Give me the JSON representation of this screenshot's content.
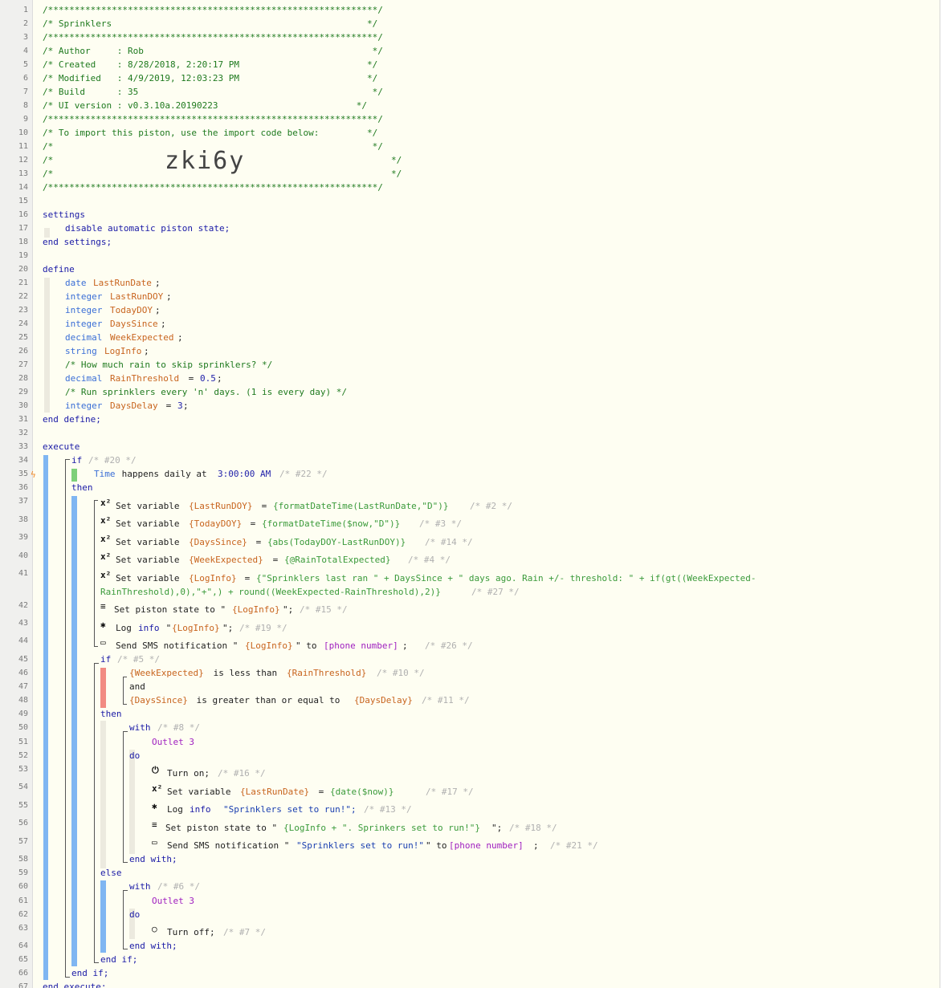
{
  "line_numbers": [
    "1",
    "2",
    "3",
    "4",
    "5",
    "6",
    "7",
    "8",
    "9",
    "10",
    "11",
    "12",
    "13",
    "14",
    "15",
    "16",
    "17",
    "18",
    "19",
    "20",
    "21",
    "22",
    "23",
    "24",
    "25",
    "26",
    "27",
    "28",
    "29",
    "30",
    "31",
    "32",
    "33",
    "34",
    "35",
    "36",
    "37",
    "38",
    "39",
    "40",
    "41",
    "42",
    "43",
    "44",
    "45",
    "46",
    "47",
    "48",
    "49",
    "50",
    "51",
    "52",
    "53",
    "54",
    "55",
    "56",
    "57",
    "58",
    "59",
    "60",
    "61",
    "62",
    "63",
    "64",
    "65",
    "66",
    "67"
  ],
  "header": {
    "border": "/**************************************************************/",
    "title": "/* Sprinklers                                                */",
    "author": "/* Author     : Rob                                           */",
    "created": "/* Created    : 8/28/2018, 2:20:17 PM                        */",
    "modified": "/* Modified   : 4/9/2019, 12:03:23 PM                        */",
    "build": "/* Build      : 35                                            */",
    "ui_version": "/* UI version : v0.3.10a.20190223                          */",
    "import_text": "/* To import this piston, use the import code below:         */",
    "blank_comment": "/*                                                            */",
    "comment_open": "/*",
    "comment_close": "*/",
    "import_code": "zki6y"
  },
  "settings": {
    "open": "settings",
    "line": "disable automatic piston state;",
    "close": "end settings;"
  },
  "define": {
    "open": "define",
    "close": "end define;",
    "vars": [
      {
        "type": "date",
        "name": "LastRunDate",
        "tail": ";"
      },
      {
        "type": "integer",
        "name": "LastRunDOY",
        "tail": ";"
      },
      {
        "type": "integer",
        "name": "TodayDOY",
        "tail": ";"
      },
      {
        "type": "integer",
        "name": "DaysSince",
        "tail": ";"
      },
      {
        "type": "decimal",
        "name": "WeekExpected",
        "tail": ";"
      },
      {
        "type": "string",
        "name": "LogInfo",
        "tail": ";"
      }
    ],
    "comment_rain": "/* How much rain to skip sprinklers? */",
    "rain_type": "decimal",
    "rain_name": "RainThreshold",
    "rain_eq": " = ",
    "rain_val": "0.5",
    "semi": ";",
    "comment_days": "/* Run sprinklers every 'n' days. (1 is every day) */",
    "days_type": "integer",
    "days_name": "DaysDelay",
    "days_eq": " = ",
    "days_val": "3"
  },
  "execute": {
    "open": "execute",
    "close": "end execute;",
    "if_kw": "if",
    "if_id": "/* #20 */",
    "trigger_subject": "Time",
    "trigger_text": " happens daily at ",
    "trigger_value": "3:00:00 AM",
    "trigger_id": "/* #22 */",
    "then_kw": "then",
    "set_prefix": "Set variable ",
    "eq": " = ",
    "stmts": {
      "s1_var": "{LastRunDOY}",
      "s1_expr": "{formatDateTime(LastRunDate,\"D\")}",
      "s1_id": "/* #2 */",
      "s2_var": "{TodayDOY}",
      "s2_expr": "{formatDateTime($now,\"D\")}",
      "s2_id": "/* #3 */",
      "s3_var": "{DaysSince}",
      "s3_expr": "{abs(TodayDOY-LastRunDOY)}",
      "s3_id": "/* #14 */",
      "s4_var": "{WeekExpected}",
      "s4_expr": "{@RainTotalExpected}",
      "s4_id": "/* #4 */",
      "s5_var": "{LogInfo}",
      "s5_expr1": "{\"Sprinklers last ran \" + DaysSince + \" days ago. Rain +/- threshold: \" + if(gt((WeekExpected-",
      "s5_expr2": "RainThreshold),0),\"+\",) + round((WeekExpected-RainThreshold),2)}",
      "s5_id": "/* #27 */",
      "state_prefix": "Set piston state to \"",
      "state_val": "{LogInfo}",
      "state_tail": "\";",
      "state_id": "/* #15 */",
      "log_prefix": "Log ",
      "log_level": "info",
      "log_q": " \"",
      "log_val": "{LogInfo}",
      "log_tail": "\";",
      "log_id": "/* #19 */",
      "sms_prefix": "Send SMS notification \"",
      "sms_val": "{LogInfo}",
      "sms_mid": "\" to ",
      "sms_phone": "[phone number]",
      "sms_tail": ";",
      "sms_id": "/* #26 */"
    },
    "inner_if": {
      "kw": "if",
      "id": "/* #5 */",
      "c1_var": "{WeekExpected}",
      "c1_op": " is less than ",
      "c1_val": "{RainThreshold}",
      "c1_id": "/* #10 */",
      "and_kw": "and",
      "c2_var": "{DaysSince}",
      "c2_op": " is greater than or equal to ",
      "c2_val": "{DaysDelay}",
      "c2_id": "/* #11 */",
      "then_kw": "then",
      "with_kw": "with",
      "with_id": "/* #8 */",
      "device": "Outlet 3",
      "do_kw": "do",
      "on_text": "Turn on;",
      "on_id": "/* #16 */",
      "set_var": "{LastRunDate}",
      "set_expr": "{date($now)}",
      "set_id": "/* #17 */",
      "log_msg": "\"Sprinklers set to run!\";",
      "log_id": "/* #13 */",
      "state_val": "{LogInfo + \". Sprinkers set to run!\"}",
      "state_id": "/* #18 */",
      "sms_msg": "\"Sprinklers set to run!\"",
      "sms_id": "/* #21 */",
      "end_with": "end with;",
      "else_kw": "else",
      "with2_id": "/* #6 */",
      "off_text": "Turn off;",
      "off_id": "/* #7 */",
      "end_if": "end if;"
    },
    "end_if": "end if;"
  },
  "colors": {
    "bar_blue": "#7fb6f2",
    "bar_green": "#7ed07a",
    "bar_red": "#f28b82",
    "bar_pale": "#eceadf"
  }
}
